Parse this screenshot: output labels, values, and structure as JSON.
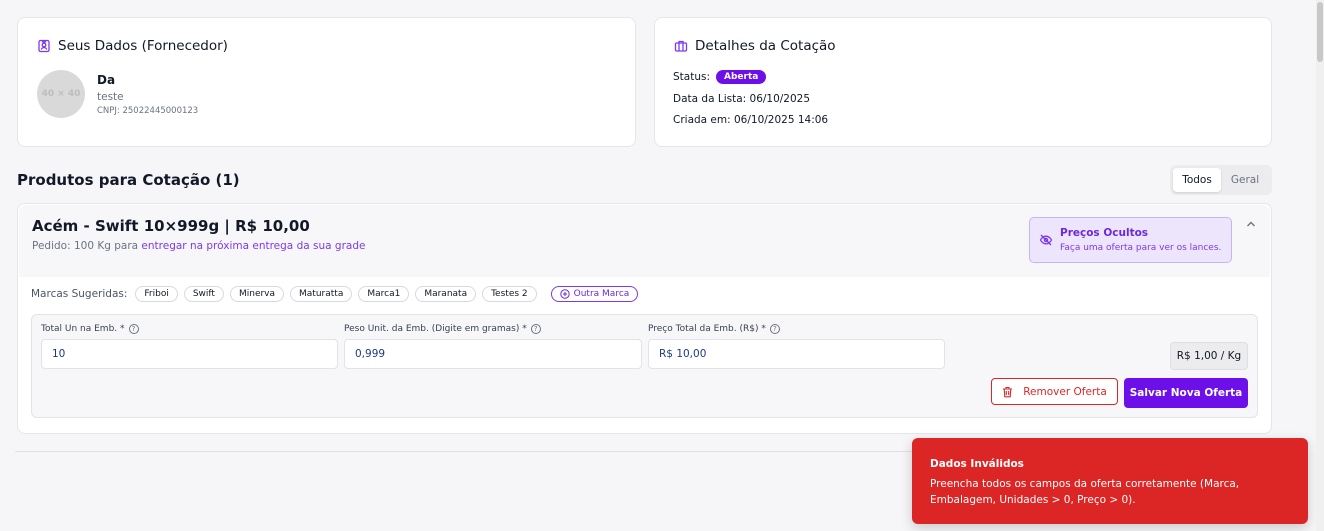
{
  "supplier": {
    "title": "Seus Dados (Fornecedor)",
    "avatar_placeholder": "40 × 40",
    "name": "Da",
    "subtitle": "teste",
    "cnpj": "CNPJ: 25022445000123"
  },
  "quote": {
    "title": "Detalhes da Cotação",
    "status_label": "Status:",
    "status_value": "Aberta",
    "list_date": "Data da Lista: 06/10/2025",
    "created": "Criada em: 06/10/2025 14:06"
  },
  "products": {
    "title": "Produtos para Cotação (1)",
    "filter_all": "Todos",
    "filter_general": "Geral"
  },
  "product": {
    "title": "Acém - Swift 10×999g | R$ 10,00",
    "order_prefix": "Pedido: 100 Kg para ",
    "order_link": "entregar na próxima entrega da sua grade",
    "hidden_title": "Preços Ocultos",
    "hidden_sub": "Faça uma oferta para ver os lances.",
    "brands_label": "Marcas Sugeridas:",
    "brands": [
      "Friboi",
      "Swift",
      "Minerva",
      "Maturatta",
      "Marca1",
      "Maranata",
      "Testes 2"
    ],
    "other_brand": "Outra Marca"
  },
  "offer": {
    "units_label": "Total Un na Emb. *",
    "units_value": "10",
    "weight_label": "Peso Unit. da Emb. (Digite em gramas) *",
    "weight_value": "0,999",
    "price_label": "Preço Total da Emb. (R$) *",
    "price_value": "R$ 10,00",
    "unit_price": "R$ 1,00 / Kg",
    "remove_label": "Remover Oferta",
    "save_label": "Salvar Nova Oferta"
  },
  "toast": {
    "title": "Dados Inválidos",
    "message": "Preencha todos os campos da oferta corretamente (Marca, Embalagem, Unidades > 0, Preço > 0)."
  },
  "colors": {
    "accent": "#6d0fe8",
    "error": "#dc2626"
  }
}
